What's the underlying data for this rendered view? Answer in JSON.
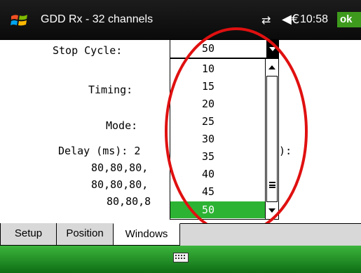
{
  "titlebar": {
    "title": "GDD Rx - 32 channels",
    "time": "10:58",
    "ok_label": "ok",
    "connectivity_glyph": "⇄",
    "volume_glyph": "◀€",
    "icons": [
      "windows-start-icon",
      "connectivity-icon",
      "speaker-icon"
    ]
  },
  "form": {
    "stop_cycle_label": "Stop Cycle:",
    "stop_cycle_value": "50",
    "timing_label": "Timing:",
    "mode_label": "Mode:",
    "delay_label": "Delay (ms): 2",
    "ms_label_fragment": "ns):",
    "delay_rows": [
      "80,80,80,",
      "80,80,80,",
      "80,80,8"
    ]
  },
  "dropdown": {
    "options": [
      "10",
      "15",
      "20",
      "25",
      "30",
      "35",
      "40",
      "45",
      "50"
    ],
    "selected": "50"
  },
  "tabs": [
    {
      "label": "Setup",
      "active": false
    },
    {
      "label": "Position",
      "active": false
    },
    {
      "label": "Windows",
      "active": true
    }
  ],
  "colors": {
    "selection": "#2db334",
    "ok_button": "#3e9a1d",
    "annotation": "#e01010",
    "bottom_bar": "#2a9a30"
  }
}
